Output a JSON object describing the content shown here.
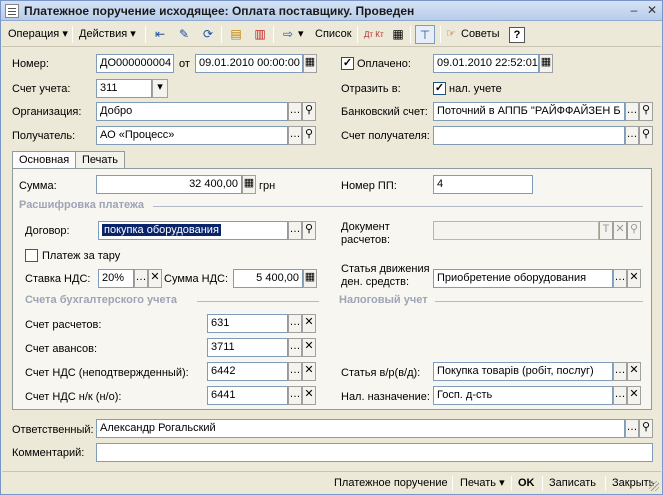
{
  "window": {
    "title": "Платежное поручение исходящее: Оплата поставщику. Проведен",
    "minimize": "–",
    "close": "✕"
  },
  "toolbar": {
    "operation": "Операция ▾",
    "actions": "Действия ▾",
    "list": "Список",
    "tips": "Советы",
    "help": "?",
    "dtkt": "Дт Кт"
  },
  "header": {
    "number_label": "Номер:",
    "number_value": "ДО000000004",
    "from_label": "от",
    "date_value": "09.01.2010 00:00:00",
    "paid_label": "Оплачено:",
    "paid_checked": "✓",
    "paid_date": "09.01.2010 22:52:01",
    "account_label": "Счет учета:",
    "account_value": "311",
    "reflect_label": "Отразить в:",
    "tax_checked": "✓",
    "tax_label": "нал. учете",
    "org_label": "Организация:",
    "org_value": "Добро",
    "bank_label": "Банковский счет:",
    "bank_value": "Поточний в АППБ \"РАЙФФАЙЗЕН Б",
    "recipient_label": "Получатель:",
    "recipient_value": "АО «Процесс»",
    "recipient_acc_label": "Счет получателя:",
    "recipient_acc_value": ""
  },
  "tabs": [
    "Основная",
    "Печать"
  ],
  "main": {
    "sum_label": "Сумма:",
    "sum_value": "32 400,00",
    "currency": "грн",
    "pp_label": "Номер ПП:",
    "pp_value": "4",
    "payment_section": "Расшифровка платежа",
    "contract_label": "Договор:",
    "contract_value": "покупка оборудования",
    "tare_label": "Платеж за тару",
    "doc_label_1": "Документ",
    "doc_label_2": "расчетов:",
    "doc_value": "",
    "vat_rate_label": "Ставка НДС:",
    "vat_rate_value": "20%",
    "vat_sum_label": "Сумма НДС:",
    "vat_sum_value": "5 400,00",
    "cash_label_1": "Статья движения",
    "cash_label_2": "ден. средств:",
    "cash_value": "Приобретение оборудования",
    "accounts_section": "Счета бухгалтерского учета",
    "tax_section": "Налоговый учет",
    "settle_label": "Счет расчетов:",
    "settle_value": "631",
    "adv_label": "Счет авансов:",
    "adv_value": "3711",
    "vat_unconf_label": "Счет НДС (неподтвержденный):",
    "vat_unconf_value": "6442",
    "vat_nk_label": "Счет НДС н/к (н/о):",
    "vat_nk_value": "6441",
    "article_label": "Статья в/р(в/д):",
    "article_value": "Покупка товарів (робіт, послуг)",
    "purpose_label": "Нал. назначение:",
    "purpose_value": "Госп. д-сть"
  },
  "footer": {
    "responsible_label": "Ответственный:",
    "responsible_value": "Александр Рогальский",
    "comment_label": "Комментарий:",
    "comment_value": ""
  },
  "statusbar": {
    "print_form": "Платежное поручение",
    "print": "Печать ▾",
    "ok": "OK",
    "save": "Записать",
    "close": "Закрыть"
  }
}
